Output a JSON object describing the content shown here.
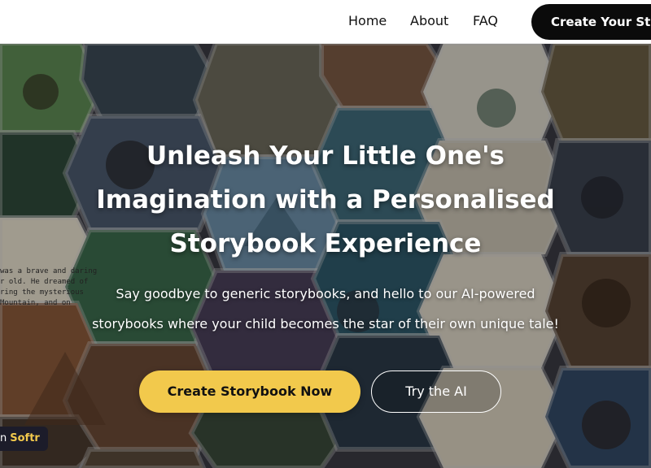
{
  "header": {
    "nav": [
      {
        "label": "Home"
      },
      {
        "label": "About"
      },
      {
        "label": "FAQ"
      }
    ],
    "cta_label": "Create Your Story"
  },
  "hero": {
    "headline_line1": "Unleash Your Little One's",
    "headline_line2": "Imagination with a Personalised",
    "headline_line3": "Storybook Experience",
    "sub_line1": "Say goodbye to generic storybooks, and hello to our AI-powered",
    "sub_line2": "storybooks where your child becomes the star of their own unique tale!",
    "primary_button": "Create Storybook Now",
    "secondary_button": "Try the AI"
  },
  "badge": {
    "prefix": "n",
    "brand": "Softr"
  },
  "story_snippet": {
    "line1": "was a brave and daring",
    "line2": "r old. He dreamed of",
    "line3": "ring the mysterious",
    "line4": "Mountain, and on"
  },
  "colors": {
    "accent": "#f2c94c",
    "header_bg": "#ffffff",
    "dark_button": "#0b0b0b"
  }
}
